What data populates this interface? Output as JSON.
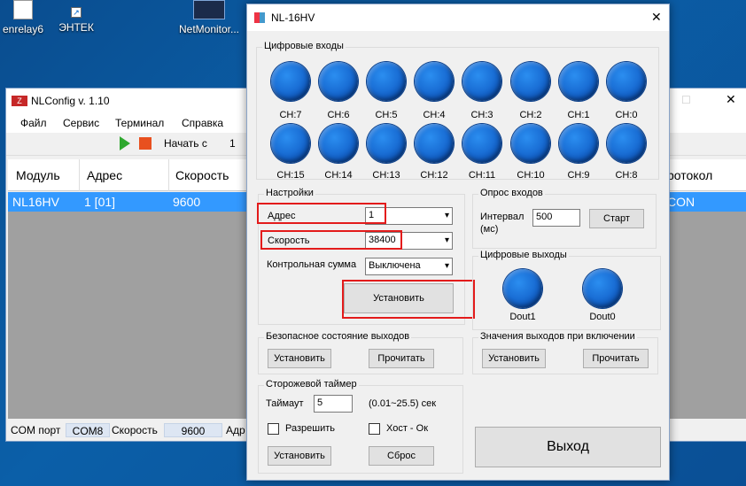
{
  "desktop": {
    "icons": [
      {
        "label": "enrelay6"
      },
      {
        "label": "ЭНТЕК"
      },
      {
        "label": "NetMonitor..."
      }
    ]
  },
  "nlconfig": {
    "title": "NLConfig v. 1.10",
    "menu": [
      "Файл",
      "Сервис",
      "Терминал",
      "Справка"
    ],
    "toolbar": {
      "start_label": "Начать с",
      "start_value": "1"
    },
    "columns": [
      "Модуль",
      "Адрес",
      "Скорость",
      "ротокол"
    ],
    "rows": [
      [
        "NL16HV",
        "1 [01]",
        "9600",
        "CON"
      ]
    ],
    "status": {
      "com_label": "COM порт",
      "com_value": "COM8",
      "speed_label": "Скорость",
      "speed_value": "9600",
      "addr_label": "Адр"
    }
  },
  "dialog": {
    "title": "NL-16HV",
    "digital_inputs": {
      "title": "Цифровые входы",
      "row1": [
        "CH:7",
        "CH:6",
        "CH:5",
        "CH:4",
        "CH:3",
        "CH:2",
        "CH:1",
        "CH:0"
      ],
      "row2": [
        "CH:15",
        "CH:14",
        "CH:13",
        "CH:12",
        "CH:11",
        "CH:10",
        "CH:9",
        "CH:8"
      ]
    },
    "settings": {
      "title": "Настройки",
      "address_label": "Адрес",
      "address_value": "1",
      "speed_label": "Скорость",
      "speed_value": "38400",
      "checksum_label": "Контрольная сумма",
      "checksum_value": "Выключена",
      "apply_button": "Установить"
    },
    "poll": {
      "title": "Опрос входов",
      "interval_label": "Интервал (мс)",
      "interval_value": "500",
      "start_button": "Старт"
    },
    "digital_outputs": {
      "title": "Цифровые выходы",
      "labels": [
        "Dout1",
        "Dout0"
      ]
    },
    "safe_state": {
      "title": "Безопасное состояние выходов",
      "set_button": "Установить",
      "read_button": "Прочитать"
    },
    "power_on": {
      "title": "Значения выходов при включении",
      "set_button": "Установить",
      "read_button": "Прочитать"
    },
    "watchdog": {
      "title": "Сторожевой таймер",
      "timeout_label": "Таймаут",
      "timeout_value": "5",
      "range_label": "(0.01~25.5) сек",
      "enable_label": "Разрешить",
      "host_ok_label": "Хост - Ок",
      "set_button": "Установить",
      "reset_button": "Сброс"
    },
    "exit_button": "Выход"
  }
}
